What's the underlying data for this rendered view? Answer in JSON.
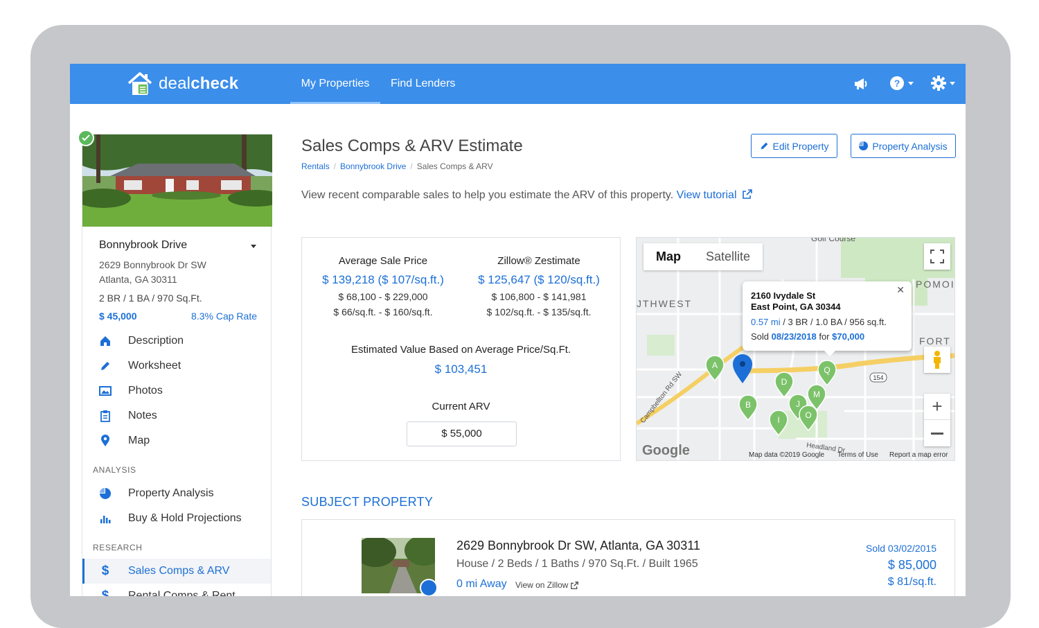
{
  "app": {
    "logo_left": "deal",
    "logo_right": "check"
  },
  "nav": {
    "my_properties": "My Properties",
    "find_lenders": "Find Lenders"
  },
  "sidebar": {
    "name": "Bonnybrook Drive",
    "address_line1": "2629 Bonnybrook Dr SW",
    "address_line2": "Atlanta, GA 30311",
    "specs": "2 BR  /  1 BA  /  970 Sq.Ft.",
    "price": "$ 45,000",
    "cap_rate": "8.3% Cap Rate",
    "items": [
      {
        "label": "Description"
      },
      {
        "label": "Worksheet"
      },
      {
        "label": "Photos"
      },
      {
        "label": "Notes"
      },
      {
        "label": "Map"
      }
    ],
    "analysis_heading": "ANALYSIS",
    "analysis_items": [
      {
        "label": "Property Analysis"
      },
      {
        "label": "Buy & Hold Projections"
      }
    ],
    "research_heading": "RESEARCH",
    "research_items": [
      {
        "label": "Sales Comps & ARV"
      },
      {
        "label": "Rental Comps & Rent"
      }
    ]
  },
  "page": {
    "title": "Sales Comps & ARV Estimate",
    "edit_button": "Edit Property",
    "analysis_button": "Property Analysis",
    "breadcrumbs": [
      "Rentals",
      "Bonnybrook Drive",
      "Sales Comps & ARV"
    ],
    "intro": "View recent comparable sales to help you estimate the ARV of this property.",
    "intro_link": "View tutorial"
  },
  "stats": {
    "avg_label": "Average Sale Price",
    "avg_value": "$ 139,218 ($ 107/sq.ft.)",
    "avg_range": "$ 68,100  -  $ 229,000",
    "avg_sqft_range": "$ 66/sq.ft.  -  $ 160/sq.ft.",
    "zillow_label": "Zillow® Zestimate",
    "zillow_value": "$ 125,647 ($ 120/sq.ft.)",
    "zillow_range": "$ 106,800  -  $ 141,981",
    "zillow_sqft_range": "$ 102/sq.ft.  -  $ 135/sq.ft.",
    "est_label": "Estimated Value Based on Average Price/Sq.Ft.",
    "est_value": "$ 103,451",
    "arv_label": "Current ARV",
    "arv_value": "$ 55,000"
  },
  "map": {
    "tab_map": "Map",
    "tab_satellite": "Satellite",
    "info_street": "2160 Ivydale St",
    "info_city": "East Point, GA 30344",
    "info_dist": "0.57 mi",
    "info_specs": " / 3 BR / 1.0 BA / 956 sq.ft.",
    "info_sold": "Sold ",
    "info_date": "08/23/2018",
    "info_for": " for ",
    "info_price": "$70,000",
    "labels": {
      "golf": "Golf Course",
      "southwest": "JTHWEST",
      "pomo": "POMOI",
      "fort": "FORT",
      "campbellton": "Campbellton Rd SW",
      "headland": "Headland Dr",
      "route": "154"
    },
    "markers": [
      "A",
      "B",
      "D",
      "I",
      "J",
      "M",
      "O",
      "Q"
    ],
    "google": "Google",
    "footer_data": "Map data ©2019 Google",
    "footer_terms": "Terms of Use",
    "footer_report": "Report a map error"
  },
  "subject": {
    "heading": "SUBJECT PROPERTY",
    "address": "2629 Bonnybrook Dr SW, Atlanta, GA 30311",
    "specs": "House  /  2 Beds  /  1 Baths  /  970 Sq.Ft.  /  Built 1965",
    "distance": "0 mi Away",
    "zillow_link": "View on Zillow",
    "sold_label": "Sold",
    "sold_date": "03/02/2015",
    "price": "$ 85,000",
    "per_sqft": "$ 81/sq.ft."
  },
  "colors": {
    "primary": "#3b8eea",
    "link": "#1c6fd6",
    "pin": "#7cc26a"
  }
}
